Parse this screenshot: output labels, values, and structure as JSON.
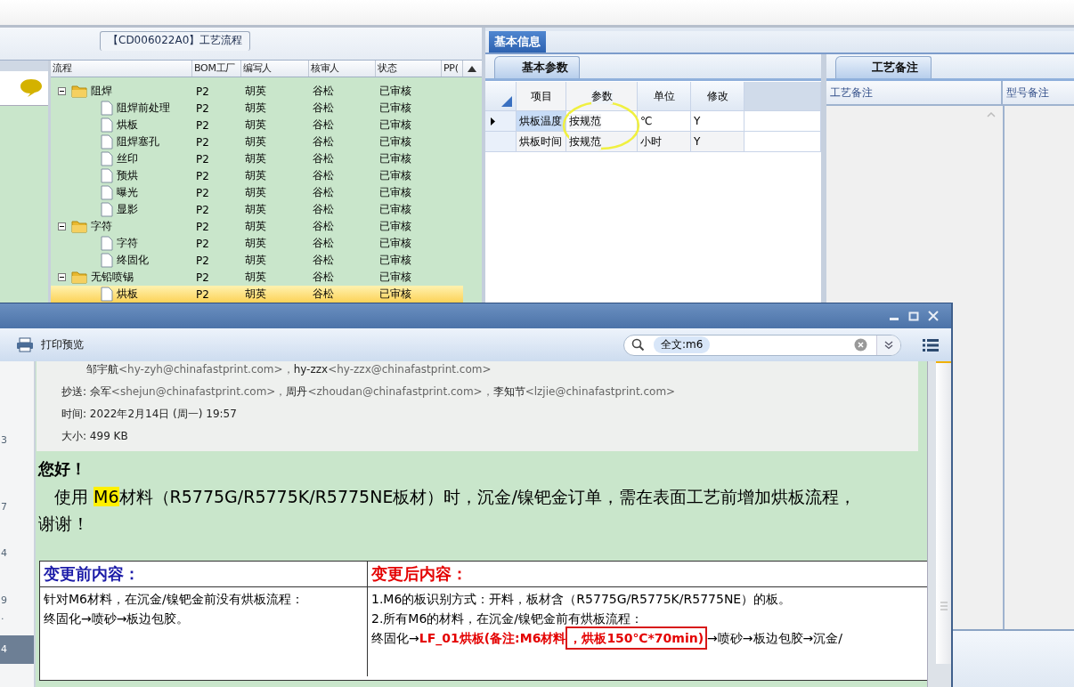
{
  "main_window": {
    "process_tab": "【CD006022A0】工艺流程",
    "process_tree": {
      "columns": [
        "流程",
        "BOM工厂",
        "编写人",
        "核审人",
        "状态",
        "PP("
      ],
      "rows": [
        {
          "name": "阻焊",
          "kind": "folder",
          "expanded": true,
          "factory": "P2",
          "writer": "胡英",
          "reviewer": "谷松",
          "status": "已审核",
          "selected": false,
          "children": [
            {
              "name": "阻焊前处理",
              "kind": "step",
              "factory": "P2",
              "writer": "胡英",
              "reviewer": "谷松",
              "status": "已审核",
              "selected": false
            },
            {
              "name": "烘板",
              "kind": "step",
              "factory": "P2",
              "writer": "胡英",
              "reviewer": "谷松",
              "status": "已审核",
              "selected": false
            },
            {
              "name": "阻焊塞孔",
              "kind": "step",
              "factory": "P2",
              "writer": "胡英",
              "reviewer": "谷松",
              "status": "已审核",
              "selected": false
            },
            {
              "name": "丝印",
              "kind": "step",
              "factory": "P2",
              "writer": "胡英",
              "reviewer": "谷松",
              "status": "已审核",
              "selected": false
            },
            {
              "name": "预烘",
              "kind": "step",
              "factory": "P2",
              "writer": "胡英",
              "reviewer": "谷松",
              "status": "已审核",
              "selected": false
            },
            {
              "name": "曝光",
              "kind": "step",
              "factory": "P2",
              "writer": "胡英",
              "reviewer": "谷松",
              "status": "已审核",
              "selected": false
            },
            {
              "name": "显影",
              "kind": "step",
              "factory": "P2",
              "writer": "胡英",
              "reviewer": "谷松",
              "status": "已审核",
              "selected": false
            }
          ]
        },
        {
          "name": "字符",
          "kind": "folder",
          "expanded": true,
          "factory": "P2",
          "writer": "胡英",
          "reviewer": "谷松",
          "status": "已审核",
          "selected": false,
          "children": [
            {
              "name": "字符",
              "kind": "step",
              "factory": "P2",
              "writer": "胡英",
              "reviewer": "谷松",
              "status": "已审核",
              "selected": false
            },
            {
              "name": "终固化",
              "kind": "step",
              "factory": "P2",
              "writer": "胡英",
              "reviewer": "谷松",
              "status": "已审核",
              "selected": false
            }
          ]
        },
        {
          "name": "无铅喷锡",
          "kind": "folder",
          "expanded": true,
          "factory": "P2",
          "writer": "胡英",
          "reviewer": "谷松",
          "status": "已审核",
          "selected": false,
          "children": [
            {
              "name": "烘板",
              "kind": "step",
              "factory": "P2",
              "writer": "胡英",
              "reviewer": "谷松",
              "status": "已审核",
              "selected": true
            }
          ]
        }
      ]
    },
    "info_tab": {
      "label": "基本信息",
      "selected": true
    },
    "params": {
      "tab": "基本参数",
      "columns": [
        "项目",
        "参数",
        "单位",
        "修改"
      ],
      "rows": [
        {
          "item": "烘板温度",
          "value": "按规范",
          "unit": "℃",
          "modified": "Y",
          "current": true
        },
        {
          "item": "烘板时间",
          "value": "按规范",
          "unit": "小时",
          "modified": "Y",
          "current": false
        }
      ]
    },
    "notes": {
      "tab": "工艺备注",
      "columns": [
        "工艺备注",
        "型号备注"
      ]
    }
  },
  "mail_window": {
    "toolbar": {
      "print_button": "打印预览",
      "search_chip": "全文:m6"
    },
    "list": [
      {
        "text": "3",
        "selected": false
      },
      {
        "text": "7",
        "selected": false
      },
      {
        "text": "4",
        "selected": false
      },
      {
        "text": "9",
        "selected": false
      },
      {
        "text": ".",
        "selected": false
      },
      {
        "text": "4",
        "selected": true
      }
    ],
    "header": [
      {
        "contacts": [
          {
            "name": "邹宇航",
            "address": "<hy-zyh@chinafastprint.com>，"
          },
          {
            "name": "hy-zzx",
            "address": "<hy-zzx@chinafastprint.com>"
          }
        ]
      },
      {
        "label": "抄送: ",
        "contacts": [
          {
            "name": "佘军",
            "address": "<shejun@chinafastprint.com>，"
          },
          {
            "name": "周丹",
            "address": "<zhoudan@chinafastprint.com>，"
          },
          {
            "name": "李知节",
            "address": "<lzjie@chinafastprint.com>"
          }
        ]
      },
      {
        "label": "时间: 2022年2月14日 (周一) 19:57"
      },
      {
        "label": "大小: 499 KB"
      }
    ],
    "greeting": "您好！",
    "paragraph": [
      {
        "text": "使用 ",
        "highlight": false
      },
      {
        "text": "M6",
        "highlight": true
      },
      {
        "text": "材料（R5775G/R5775K/R5775NE板材）时，沉金/镍钯金订单，需在表面工艺前增加烘板流程，谢谢！",
        "highlight": false
      }
    ],
    "change_table": {
      "headers": [
        {
          "text": "变更前内容：",
          "color": "#1c1ca8"
        },
        {
          "text": "变更后内容：",
          "color": "#e40000"
        }
      ],
      "before": [
        "针对M6材料，在沉金/镍钯金前没有烘板流程：",
        "终固化→喷砂→板边包胶。"
      ],
      "after": [
        [
          {
            "text": "1.M6的板识别方式：开料，板材含（R5775G/R5775K/R5775NE）的板。",
            "emph": false,
            "boxed": false
          }
        ],
        [
          {
            "text": "2.所有M6的材料，在沉金/镍钯金前有烘板流程：",
            "emph": false,
            "boxed": false
          }
        ],
        [
          {
            "text": "终固化→",
            "emph": false,
            "boxed": false
          },
          {
            "text": "LF_01烘板(备注:M6材料",
            "emph": true,
            "boxed": false
          },
          {
            "text": "，烘板150℃*70min)",
            "emph": true,
            "boxed": true
          },
          {
            "text": "→喷砂→板边包胶→沉金/",
            "emph": false,
            "boxed": false
          }
        ]
      ]
    }
  }
}
